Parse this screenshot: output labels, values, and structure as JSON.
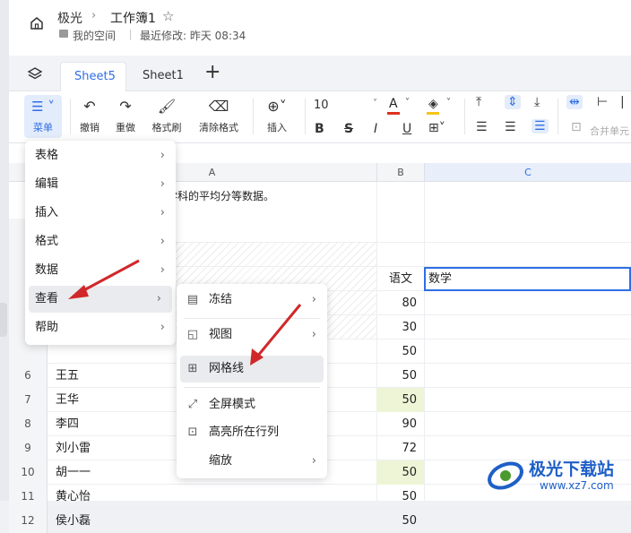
{
  "header": {
    "breadcrumb_root": "极光",
    "doc_title": "工作簿1",
    "space": "我的空间",
    "modified": "最近修改: 昨天 08:34"
  },
  "tabs": [
    {
      "label": "Sheet5",
      "active": true
    },
    {
      "label": "Sheet1",
      "active": false
    }
  ],
  "toolbar": {
    "menu": "菜单",
    "undo": "撤销",
    "redo": "重做",
    "format_painter": "格式刷",
    "clear_format": "清除格式",
    "insert": "插入",
    "font_size": "10",
    "bold": "B",
    "strike": "S",
    "italic": "I",
    "underline": "U",
    "merge": "合并单元",
    "accent_color": "#2f6ee6",
    "font_color": "#e0301e",
    "fill_color": "#f5c518"
  },
  "columns": [
    "A",
    "B",
    "C"
  ],
  "rows": [
    {
      "n": "",
      "a": "",
      "b": "",
      "c": ""
    },
    {
      "n": "",
      "a": "",
      "b": "",
      "c": ""
    },
    {
      "n": "",
      "a": "",
      "b": "语文",
      "c": "数学"
    },
    {
      "n": "",
      "a": "",
      "b": "80",
      "c": ""
    },
    {
      "n": "",
      "a": "",
      "b": "30",
      "c": ""
    },
    {
      "n": "",
      "a": "",
      "b": "50",
      "c": ""
    },
    {
      "n": "6",
      "a": "王五",
      "b": "50",
      "c": ""
    },
    {
      "n": "7",
      "a": "王华",
      "b": "50",
      "c": ""
    },
    {
      "n": "8",
      "a": "李四",
      "b": "90",
      "c": ""
    },
    {
      "n": "9",
      "a": "刘小雷",
      "b": "72",
      "c": ""
    },
    {
      "n": "10",
      "a": "胡一一",
      "b": "50",
      "c": ""
    },
    {
      "n": "11",
      "a": "黄心怡",
      "b": "50",
      "c": ""
    },
    {
      "n": "12",
      "a": "侯小磊",
      "b": "50",
      "c": ""
    }
  ],
  "note_text": "计学科的平均分等数据。",
  "main_menu": [
    "表格",
    "编辑",
    "插入",
    "格式",
    "数据",
    "查看",
    "帮助"
  ],
  "view_submenu": {
    "freeze": "冻结",
    "view": "视图",
    "gridlines": "网格线",
    "fullscreen": "全屏模式",
    "highlight": "高亮所在行列",
    "zoom": "缩放"
  },
  "watermark": {
    "title": "极光下载站",
    "url": "www.xz7.com"
  }
}
